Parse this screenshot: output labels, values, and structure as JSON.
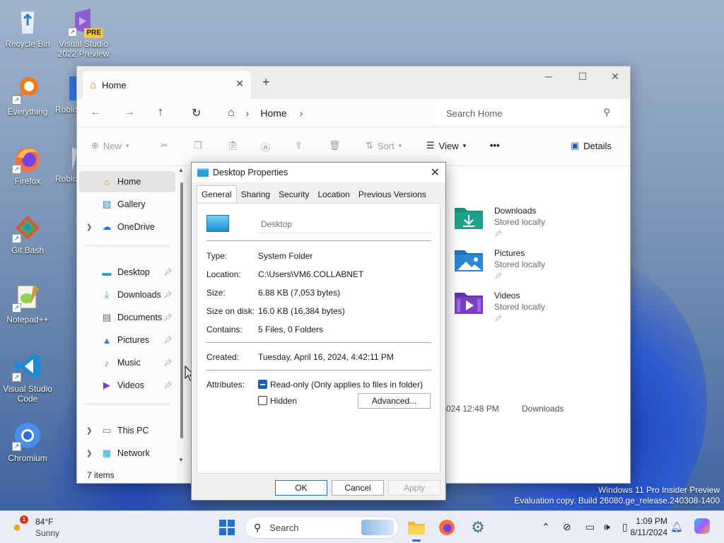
{
  "desktop": {
    "icons": [
      {
        "label": "Recycle Bin"
      },
      {
        "label": "Visual Studio 2022 Preview",
        "badge": "PRE"
      },
      {
        "label": "Everything"
      },
      {
        "label": "Roblo"
      },
      {
        "label": "Firefox"
      },
      {
        "label": "Roblo"
      },
      {
        "label": "Git Bash"
      },
      {
        "label": "Notepad++"
      },
      {
        "label": "Visual Studio Code"
      },
      {
        "label": "Chromium"
      }
    ],
    "watermark": {
      "line1": "Windows 11 Pro Insider Preview",
      "line2": "Evaluation copy. Build 26080.ge_release.240308-1400"
    }
  },
  "explorer": {
    "tab_label": "Home",
    "address_crumb": "Home",
    "search_placeholder": "Search Home",
    "commands": {
      "new": "New",
      "sort": "Sort",
      "view": "View",
      "more": "•••",
      "details": "Details"
    },
    "nav": {
      "top": [
        {
          "label": "Home"
        },
        {
          "label": "Gallery"
        },
        {
          "label": "OneDrive"
        }
      ],
      "quick": [
        {
          "label": "Desktop"
        },
        {
          "label": "Downloads"
        },
        {
          "label": "Documents"
        },
        {
          "label": "Pictures"
        },
        {
          "label": "Music"
        },
        {
          "label": "Videos"
        }
      ],
      "bottom": [
        {
          "label": "This PC"
        },
        {
          "label": "Network"
        }
      ]
    },
    "status": "7 items",
    "folders": [
      {
        "name": "Downloads",
        "sub": "Stored locally"
      },
      {
        "name": "Pictures",
        "sub": "Stored locally"
      },
      {
        "name": "Videos",
        "sub": "Stored locally"
      }
    ],
    "recent": {
      "date_fragment": "024 12:48 PM",
      "location": "Downloads"
    }
  },
  "dialog": {
    "title": "Desktop Properties",
    "tabs": [
      "General",
      "Sharing",
      "Security",
      "Location",
      "Previous Versions"
    ],
    "name_value": "Desktop",
    "props": [
      {
        "key": "Type:",
        "value": "System Folder"
      },
      {
        "key": "Location:",
        "value": "C:\\Users\\VM6.COLLABNET"
      },
      {
        "key": "Size:",
        "value": "6.88 KB (7,053 bytes)"
      },
      {
        "key": "Size on disk:",
        "value": "16.0 KB (16,384 bytes)"
      },
      {
        "key": "Contains:",
        "value": "5 Files, 0 Folders"
      }
    ],
    "created": {
      "key": "Created:",
      "value": "Tuesday, April 16, 2024, 4:42:11 PM"
    },
    "attributes": {
      "key": "Attributes:",
      "readonly": "Read-only (Only applies to files in folder)",
      "readonly_checked": true,
      "hidden": "Hidden",
      "hidden_checked": false,
      "advanced": "Advanced..."
    },
    "buttons": {
      "ok": "OK",
      "cancel": "Cancel",
      "apply": "Apply"
    }
  },
  "taskbar": {
    "weather_temp": "84°F",
    "weather_cond": "Sunny",
    "weather_badge": "1",
    "search_label": "Search",
    "time": "1:09 PM",
    "date": "8/11/2024"
  },
  "colors": {
    "accent": "#1a5fb4",
    "folder_teal": "#1ea38a",
    "folder_blue": "#2b86d6",
    "folder_purple": "#7b3fc4"
  }
}
